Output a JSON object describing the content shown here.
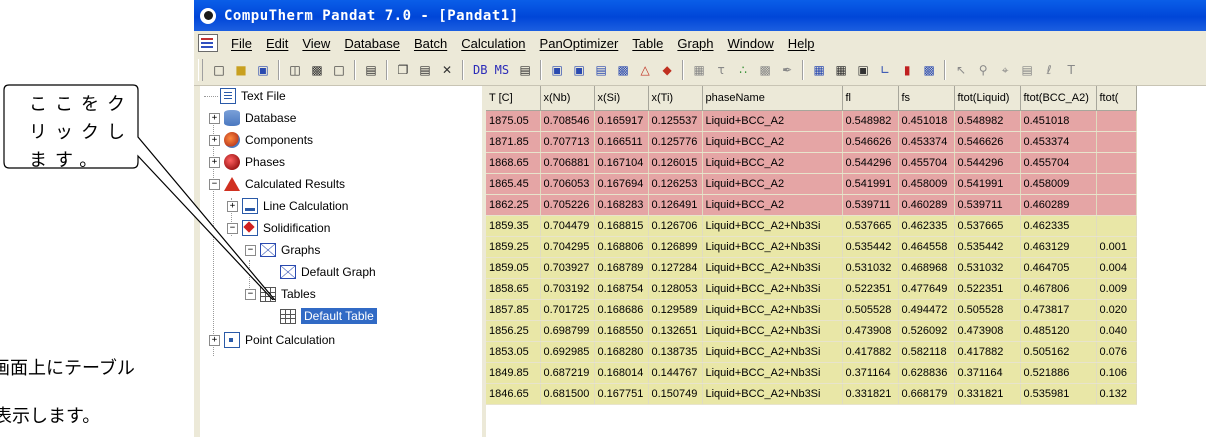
{
  "window": {
    "title": "CompuTherm Pandat 7.0 - [Pandat1]"
  },
  "menu": [
    "File",
    "Edit",
    "View",
    "Database",
    "Batch",
    "Calculation",
    "PanOptimizer",
    "Table",
    "Graph",
    "Window",
    "Help"
  ],
  "toolbar": {
    "db_ms": "DB MS"
  },
  "tree": {
    "text_file": "Text File",
    "database": "Database",
    "components": "Components",
    "phases": "Phases",
    "calculated_results": "Calculated Results",
    "line_calculation": "Line Calculation",
    "solidification": "Solidification",
    "graphs": "Graphs",
    "default_graph": "Default Graph",
    "tables": "Tables",
    "default_table": "Default Table",
    "point_calculation": "Point Calculation",
    "expander_plus": "+",
    "expander_minus": "−"
  },
  "table": {
    "headers": [
      "T [C]",
      "x(Nb)",
      "x(Si)",
      "x(Ti)",
      "phaseName",
      "fl",
      "fs",
      "ftot(Liquid)",
      "ftot(BCC_A2)",
      "ftot("
    ],
    "rows": [
      {
        "type": "liquid",
        "cells": [
          "1875.05",
          "0.708546",
          "0.165917",
          "0.125537",
          "Liquid+BCC_A2",
          "0.548982",
          "0.451018",
          "0.548982",
          "0.451018",
          ""
        ]
      },
      {
        "type": "liquid",
        "cells": [
          "1871.85",
          "0.707713",
          "0.166511",
          "0.125776",
          "Liquid+BCC_A2",
          "0.546626",
          "0.453374",
          "0.546626",
          "0.453374",
          ""
        ]
      },
      {
        "type": "liquid",
        "cells": [
          "1868.65",
          "0.706881",
          "0.167104",
          "0.126015",
          "Liquid+BCC_A2",
          "0.544296",
          "0.455704",
          "0.544296",
          "0.455704",
          ""
        ]
      },
      {
        "type": "liquid",
        "cells": [
          "1865.45",
          "0.706053",
          "0.167694",
          "0.126253",
          "Liquid+BCC_A2",
          "0.541991",
          "0.458009",
          "0.541991",
          "0.458009",
          ""
        ]
      },
      {
        "type": "liquid",
        "cells": [
          "1862.25",
          "0.705226",
          "0.168283",
          "0.126491",
          "Liquid+BCC_A2",
          "0.539711",
          "0.460289",
          "0.539711",
          "0.460289",
          ""
        ]
      },
      {
        "type": "solid",
        "cells": [
          "1859.35",
          "0.704479",
          "0.168815",
          "0.126706",
          "Liquid+BCC_A2+Nb3Si",
          "0.537665",
          "0.462335",
          "0.537665",
          "0.462335",
          ""
        ]
      },
      {
        "type": "solid",
        "cells": [
          "1859.25",
          "0.704295",
          "0.168806",
          "0.126899",
          "Liquid+BCC_A2+Nb3Si",
          "0.535442",
          "0.464558",
          "0.535442",
          "0.463129",
          "0.001"
        ]
      },
      {
        "type": "solid",
        "cells": [
          "1859.05",
          "0.703927",
          "0.168789",
          "0.127284",
          "Liquid+BCC_A2+Nb3Si",
          "0.531032",
          "0.468968",
          "0.531032",
          "0.464705",
          "0.004"
        ]
      },
      {
        "type": "solid",
        "cells": [
          "1858.65",
          "0.703192",
          "0.168754",
          "0.128053",
          "Liquid+BCC_A2+Nb3Si",
          "0.522351",
          "0.477649",
          "0.522351",
          "0.467806",
          "0.009"
        ]
      },
      {
        "type": "solid",
        "cells": [
          "1857.85",
          "0.701725",
          "0.168686",
          "0.129589",
          "Liquid+BCC_A2+Nb3Si",
          "0.505528",
          "0.494472",
          "0.505528",
          "0.473817",
          "0.020"
        ]
      },
      {
        "type": "solid",
        "cells": [
          "1856.25",
          "0.698799",
          "0.168550",
          "0.132651",
          "Liquid+BCC_A2+Nb3Si",
          "0.473908",
          "0.526092",
          "0.473908",
          "0.485120",
          "0.040"
        ]
      },
      {
        "type": "solid",
        "cells": [
          "1853.05",
          "0.692985",
          "0.168280",
          "0.138735",
          "Liquid+BCC_A2+Nb3Si",
          "0.417882",
          "0.582118",
          "0.417882",
          "0.505162",
          "0.076"
        ]
      },
      {
        "type": "solid",
        "cells": [
          "1849.85",
          "0.687219",
          "0.168014",
          "0.144767",
          "Liquid+BCC_A2+Nb3Si",
          "0.371164",
          "0.628836",
          "0.371164",
          "0.521886",
          "0.106"
        ]
      },
      {
        "type": "solid",
        "cells": [
          "1846.65",
          "0.681500",
          "0.167751",
          "0.150749",
          "Liquid+BCC_A2+Nb3Si",
          "0.331821",
          "0.668179",
          "0.331821",
          "0.535981",
          "0.132"
        ]
      }
    ]
  },
  "annotations": {
    "callout_lines": [
      "ここをク",
      "リックし",
      "ます。"
    ],
    "caption_lines": [
      "画面上にテーブル",
      "表示します。"
    ]
  },
  "colors": {
    "liquid_row": "#e5a5a5",
    "solid_row": "#e9e7a7",
    "selection": "#316ac5",
    "titlebar": "#0046d8"
  }
}
